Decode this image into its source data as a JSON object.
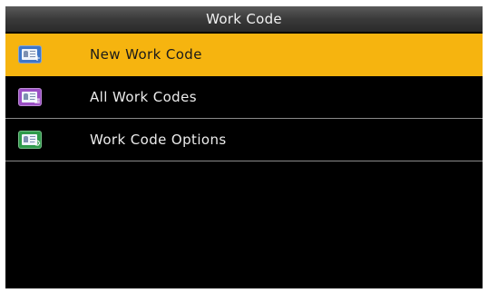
{
  "header": {
    "title": "Work Code"
  },
  "menu": {
    "items": [
      {
        "label": "New Work Code",
        "icon": "new-work-code-icon",
        "icon_color": "#3f76c7",
        "selected": true
      },
      {
        "label": "All Work Codes",
        "icon": "all-work-codes-icon",
        "icon_color": "#9b4fc4",
        "selected": false
      },
      {
        "label": "Work Code Options",
        "icon": "work-code-options-icon",
        "icon_color": "#2e9a4a",
        "selected": false
      }
    ]
  },
  "colors": {
    "selected_bg": "#f6b40f",
    "screen_bg": "#000000",
    "divider": "#8a8a8a"
  }
}
